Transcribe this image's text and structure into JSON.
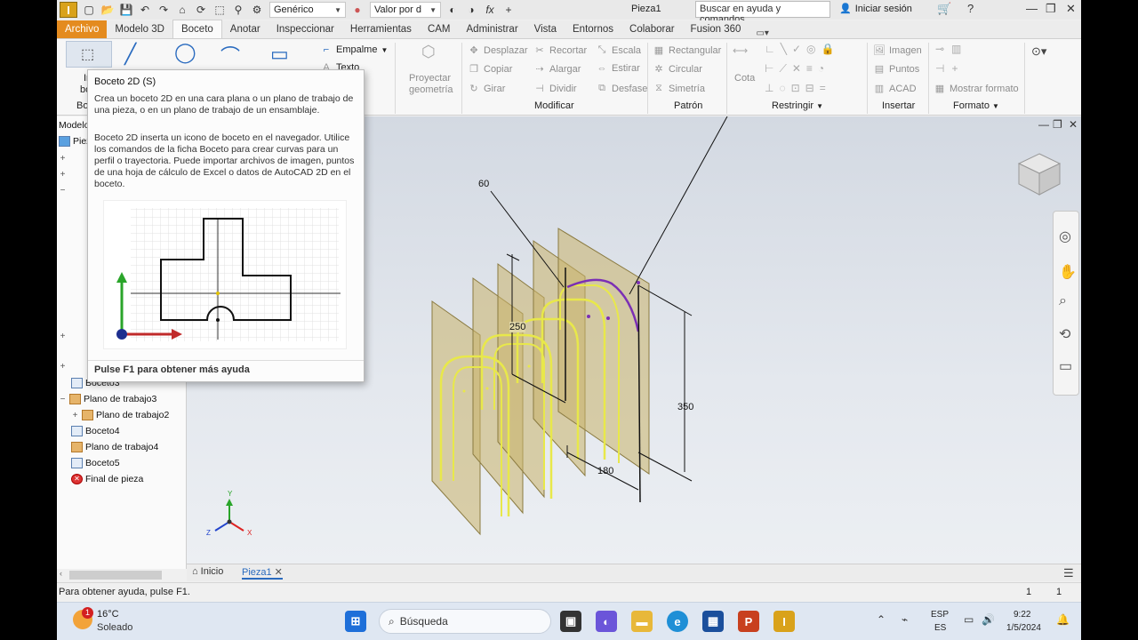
{
  "titlebar": {
    "app_letter": "I",
    "material": "Genérico",
    "appearance": "Valor por d",
    "doc_title": "Pieza1",
    "search_placeholder": "Buscar en ayuda y comandos...",
    "signin": "Iniciar sesión"
  },
  "tabs": [
    "Archivo",
    "Modelo 3D",
    "Boceto",
    "Anotar",
    "Inspeccionar",
    "Herramientas",
    "CAM",
    "Administrar",
    "Vista",
    "Entornos",
    "Colaborar",
    "Fusion 360"
  ],
  "ribbon": {
    "start_sketch_label_1": "Ini",
    "start_sketch_label_2": "boce",
    "group_boceto_short": "Bo",
    "empalme": "Empalme",
    "texto": "Texto",
    "proyectar_1": "Proyectar",
    "proyectar_2": "geometría",
    "modificar": {
      "title": "Modificar",
      "items": [
        "Desplazar",
        "Recortar",
        "Escala",
        "Copiar",
        "Alargar",
        "Estirar",
        "Girar",
        "Dividir",
        "Desfase"
      ]
    },
    "patron": {
      "title": "Patrón",
      "items": [
        "Rectangular",
        "Circular",
        "Simetría"
      ]
    },
    "restringir": {
      "title": "Restringir",
      "cota": "Cota"
    },
    "insertar": {
      "title": "Insertar",
      "items": [
        "Imagen",
        "Puntos",
        "ACAD"
      ]
    },
    "formato": {
      "title": "Formato",
      "mostrar": "Mostrar formato"
    }
  },
  "tooltip": {
    "title": "Boceto 2D",
    "shortcut": "(S)",
    "p1": "Crea un boceto 2D en una cara plana o un plano de trabajo de una pieza, o en un plano de trabajo de un ensamblaje.",
    "p2": "Boceto 2D inserta un icono de boceto en el navegador. Utilice los comandos de la ficha Boceto para crear curvas para un perfil o trayectoria. Puede importar archivos de imagen, puntos de una hoja de cálculo de Excel o datos de AutoCAD 2D en el boceto.",
    "footer": "Pulse F1 para obtener más ayuda"
  },
  "browser": {
    "header": "Modelo",
    "root": "Piez",
    "items": [
      {
        "label": "Boceto3",
        "type": "sketch"
      },
      {
        "label": "Plano de trabajo3",
        "type": "plane"
      },
      {
        "label": "Plano de trabajo2",
        "type": "plane"
      },
      {
        "label": "Boceto4",
        "type": "sketch"
      },
      {
        "label": "Plano de trabajo4",
        "type": "plane"
      },
      {
        "label": "Boceto5",
        "type": "sketch"
      },
      {
        "label": "Final de pieza",
        "type": "end"
      }
    ]
  },
  "dimensions": {
    "d60": "60",
    "d250": "250",
    "d350": "350",
    "d180": "180"
  },
  "triad": {
    "x": "X",
    "y": "Y",
    "z": "Z"
  },
  "doctabs": {
    "home": "Inicio",
    "part": "Pieza1"
  },
  "status": {
    "help": "Para obtener ayuda, pulse F1.",
    "n1": "1",
    "n2": "1"
  },
  "taskbar": {
    "weather_temp": "16°C",
    "weather_desc": "Soleado",
    "search": "Búsqueda",
    "lang_1": "ESP",
    "lang_2": "ES",
    "time": "9:22",
    "date": "1/5/2024",
    "badge": "1"
  },
  "colors": {
    "accent": "#e48b1f",
    "sketch_yellow": "#e8e84a",
    "sketch_purple": "#7b2fb5",
    "plane_fill": "#c9b26a"
  }
}
